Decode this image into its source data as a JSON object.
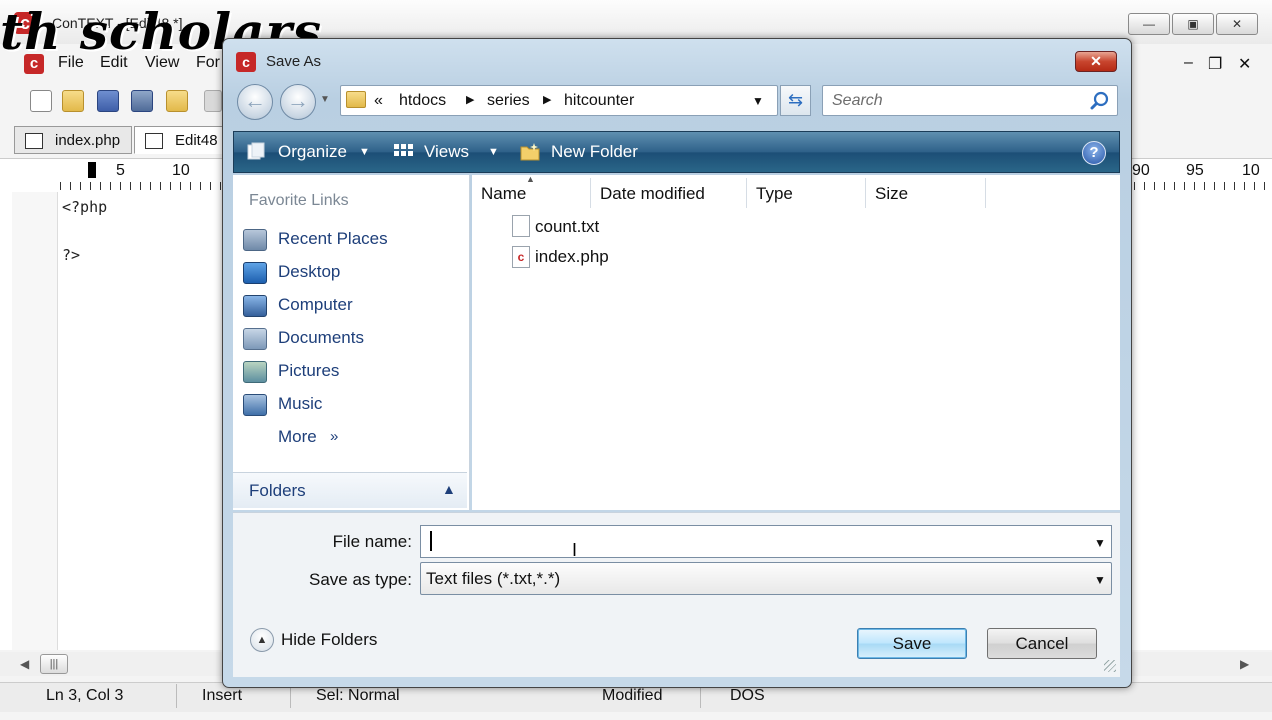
{
  "background_app": {
    "title": "ConTEXT - [Edit48 *]",
    "watermark": "th scholars",
    "menu": [
      "File",
      "Edit",
      "View",
      "For"
    ],
    "tabs": [
      "index.php",
      "Edit48"
    ],
    "ruler": {
      "left": [
        "5",
        "10"
      ],
      "right": [
        "90",
        "95",
        "10"
      ]
    },
    "code": [
      "<?php",
      "",
      "?>"
    ],
    "status": {
      "position": "Ln 3, Col 3",
      "mode": "Insert",
      "selection": "Sel: Normal",
      "modified": "Modified",
      "format": "DOS"
    }
  },
  "dialog": {
    "title": "Save As",
    "breadcrumb": [
      "«",
      "htdocs",
      "series",
      "hitcounter"
    ],
    "search_placeholder": "Search",
    "toolbar": {
      "organize": "Organize",
      "views": "Views",
      "new_folder": "New Folder"
    },
    "favorite_links_header": "Favorite Links",
    "favorite_links": [
      "Recent Places",
      "Desktop",
      "Computer",
      "Documents",
      "Pictures",
      "Music",
      "More"
    ],
    "folders_label": "Folders",
    "columns": [
      "Name",
      "Date modified",
      "Type",
      "Size"
    ],
    "files": [
      {
        "name": "count.txt",
        "kind": "text"
      },
      {
        "name": "index.php",
        "kind": "php"
      }
    ],
    "file_name_label": "File name:",
    "file_name_value": "",
    "save_as_type_label": "Save as type:",
    "save_as_type_value": "Text files (*.txt,*.*)",
    "hide_folders": "Hide Folders",
    "save_button": "Save",
    "cancel_button": "Cancel"
  },
  "colors": {
    "command_bar": "#2e6189",
    "link_text": "#1e3f7a",
    "close_button": "#c8452e",
    "app_logo": "#c62828"
  }
}
